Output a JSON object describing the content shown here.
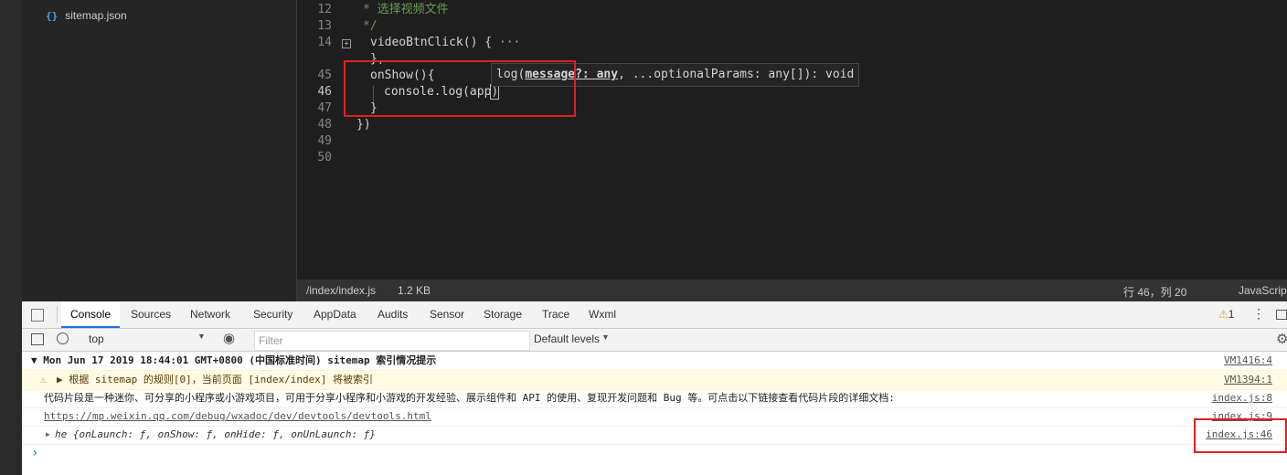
{
  "explorer": {
    "file_icon": "{}",
    "file_name": "sitemap.json"
  },
  "editor": {
    "line_numbers": [
      "12",
      "13",
      "14",
      "45",
      "45",
      "46",
      "47",
      "48",
      "49",
      "50"
    ],
    "lines": {
      "l12": "* 选择视频文件",
      "l13": "*/",
      "l14": "videoBtnClick() {",
      "l14_ellipsis": "···",
      "l45a": "},",
      "l45b": "onShow(){",
      "l46": "console.log(",
      "l46_arg": "app",
      "l46_close": ")",
      "l47": "}",
      "l48": "})"
    },
    "hint": {
      "prefix": "log(",
      "param": "message?: any",
      "rest": ", ...optionalParams: any[]): void"
    }
  },
  "status": {
    "path": "/index/index.js",
    "size": "1.2 KB",
    "position": "行 46，列 20",
    "language": "JavaScript"
  },
  "devtools": {
    "tabs": [
      "Console",
      "Sources",
      "Network",
      "Security",
      "AppData",
      "Audits",
      "Sensor",
      "Storage",
      "Trace",
      "Wxml"
    ],
    "warning_count": "1",
    "context": "top",
    "filter_placeholder": "Filter",
    "levels": "Default levels"
  },
  "console": {
    "group_header": "▼ Mon Jun 17 2019 18:44:01 GMT+0800 (中国标准时间) sitemap 索引情况提示",
    "group_source": "VM1416:4",
    "warning_text": "▶ 根据 sitemap 的规则[0]，当前页面 [index/index] 将被索引",
    "warning_source": "VM1394:1",
    "info_text": "代码片段是一种迷你、可分享的小程序或小游戏项目，可用于分享小程序和小游戏的开发经验、展示组件和 API 的使用、复现开发问题和 Bug 等。可点击以下链接查看代码片段的详细文档:",
    "info_source": "index.js:8",
    "url": "https://mp.weixin.qq.com/debug/wxadoc/dev/devtools/devtools.html",
    "url_source": "index.js:9",
    "object_text": "he {onLaunch: ƒ, onShow: ƒ, onHide: ƒ, onUnLaunch: ƒ}",
    "object_source": "index.js:46",
    "prompt": "›"
  }
}
